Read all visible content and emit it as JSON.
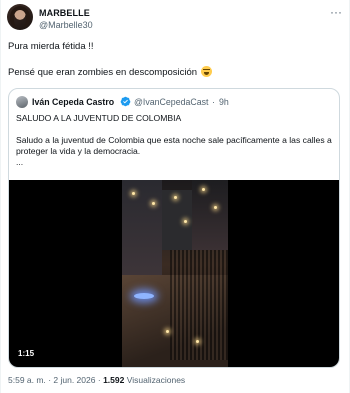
{
  "tweet": {
    "display_name": "MARBELLE",
    "handle": "@Marbelle30",
    "more_icon": "more-horizontal-icon",
    "text": "Pura mierda fétida !!\n\nPensé que eran zombies en descomposición",
    "emoji": "rolling-on-floor-laughing-icon",
    "time": "5:59 a. m.",
    "separator": "·",
    "date": "2 jun. 2026",
    "separator2": "·",
    "views_count": "1.592",
    "views_label": "Visualizaciones"
  },
  "quoted": {
    "display_name": "Iván Cepeda Castro",
    "verified_icon": "verified-badge-icon",
    "handle": "@IvanCepedaCast",
    "separator": "·",
    "time": "9h",
    "text": "SALUDO A LA JUVENTUD DE COLOMBIA\n\nSaludo a la juventud de Colombia que esta noche sale pacíficamente a las calles a proteger la vida y la democracia.\n...",
    "video": {
      "duration": "1:15"
    }
  },
  "colors": {
    "secondary_text": "#536471",
    "border": "#cfd9de",
    "verified": "#1d9bf0"
  }
}
